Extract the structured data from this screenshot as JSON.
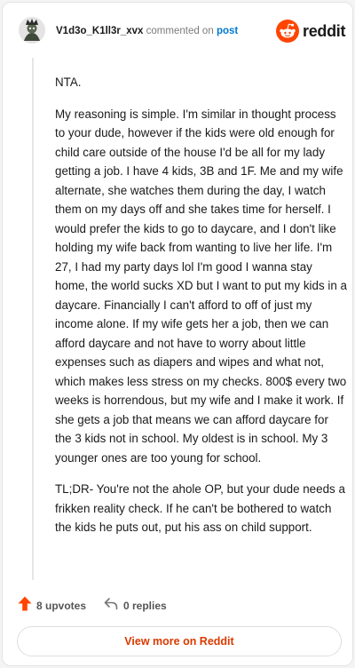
{
  "header": {
    "username": "V1d3o_K1ll3r_xvx",
    "action_text": "commented on",
    "post_link": "post",
    "brand": "reddit"
  },
  "comment": {
    "paragraphs": [
      "NTA.",
      "My reasoning is simple. I'm similar in thought process to your dude, however if the kids were old enough for child care outside of the house I'd be all for my lady getting a job. I have 4 kids, 3B and 1F. Me and my wife alternate, she watches them during the day, I watch them on my days off and she takes time for herself. I would prefer the kids to go to daycare, and I don't like holding my wife back from wanting to live her life. I'm 27, I had my party days lol I'm good I wanna stay home, the world sucks XD but I want to put my kids in a daycare. Financially I can't afford to off of just my income alone. If my wife gets her a job, then we can afford daycare and not have to worry about little expenses such as diapers and wipes and what not, which makes less stress on my checks. 800$ every two weeks is horrendous, but my wife and I make it work. If she gets a job that means we can afford daycare for the 3 kids not in school. My oldest is in school. My 3 younger ones are too young for school.",
      "TL;DR- You're not the ahole OP, but your dude needs a frikken reality check. If he can't be bothered to watch the kids he puts out, put his ass on child support."
    ]
  },
  "footer": {
    "upvotes_label": "8 upvotes",
    "replies_label": "0 replies",
    "view_more_label": "View more on Reddit"
  },
  "colors": {
    "brand_orange": "#ff4500",
    "link_blue": "#0079d3",
    "view_more_text": "#d93a00"
  },
  "icons": {
    "avatar": "avatar-icon",
    "brand": "reddit-logo-icon",
    "upvote": "upvote-arrow-icon",
    "reply": "reply-arrow-icon"
  }
}
